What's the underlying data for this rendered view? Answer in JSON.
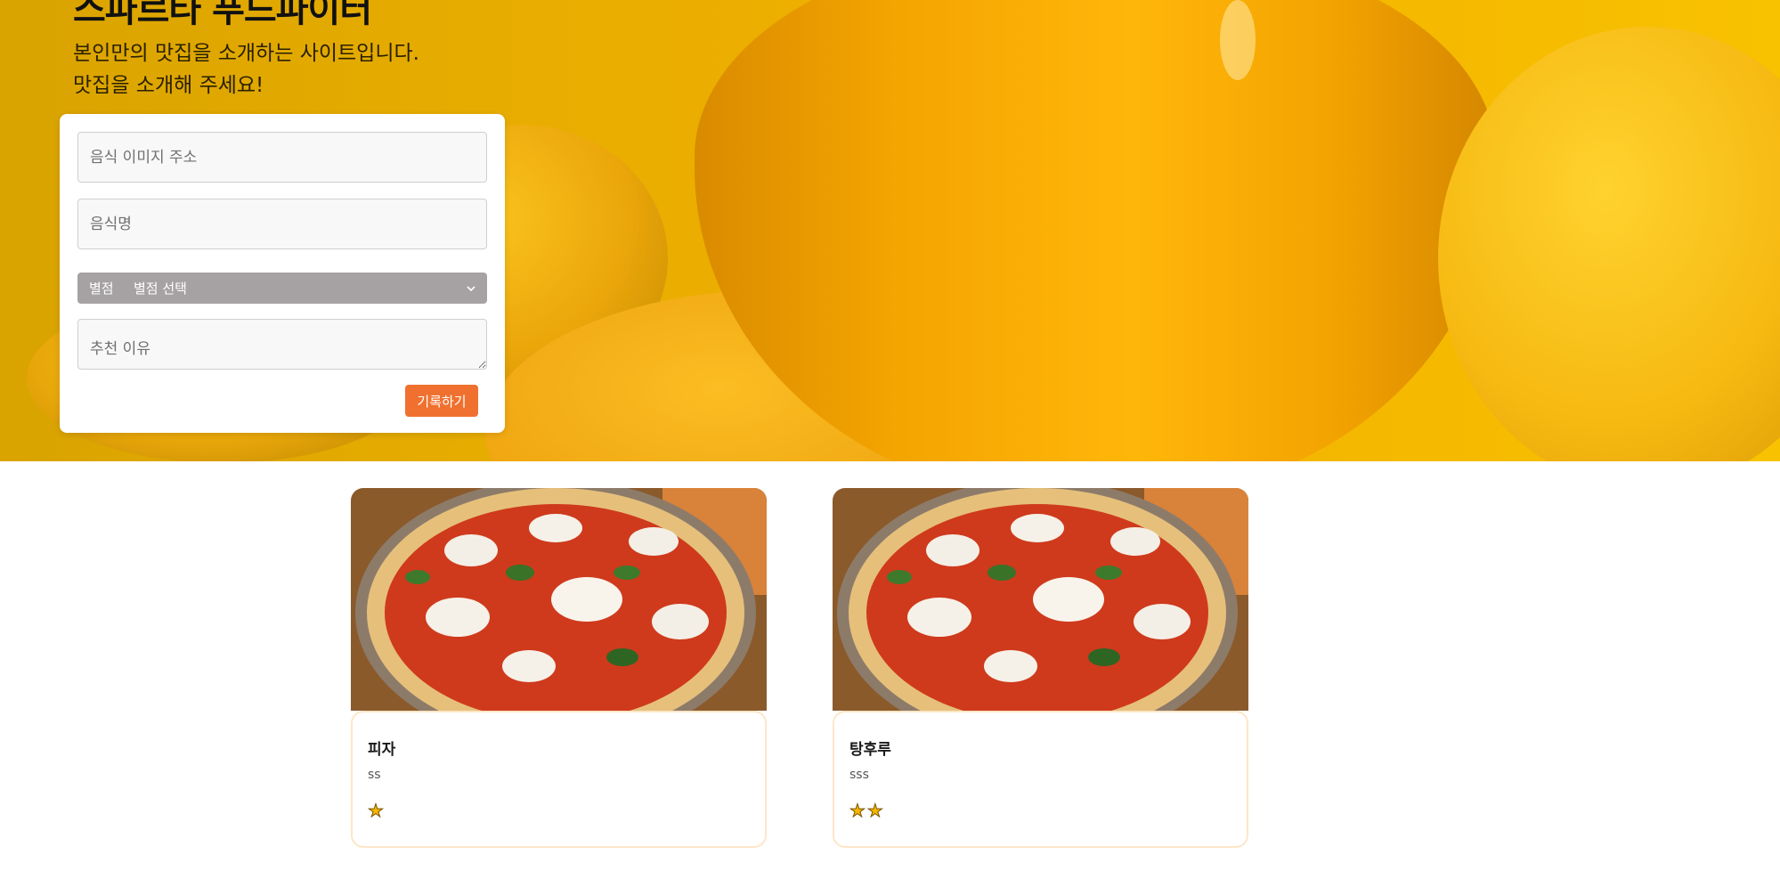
{
  "hero": {
    "title": "스파르타 푸드파이터",
    "description_lines": [
      "본인만의 맛집을 소개하는 사이트입니다.",
      "맛집을 소개해 주세요!"
    ]
  },
  "form": {
    "image_url_placeholder": "음식 이미지 주소",
    "food_name_placeholder": "음식명",
    "rating_label": "별점",
    "rating_selected": "별점 선택",
    "reason_placeholder": "추천 이유",
    "submit_label": "기록하기"
  },
  "cards": [
    {
      "title": "피자",
      "comment": "ss",
      "stars": "★",
      "star_count": 1
    },
    {
      "title": "탕후루",
      "comment": "sss",
      "stars": "★★",
      "star_count": 2
    }
  ],
  "colors": {
    "accent": "#f0712f",
    "card_border": "#fde6c8",
    "star": "#f6b800",
    "rating_bar": "#a6a2a3"
  }
}
